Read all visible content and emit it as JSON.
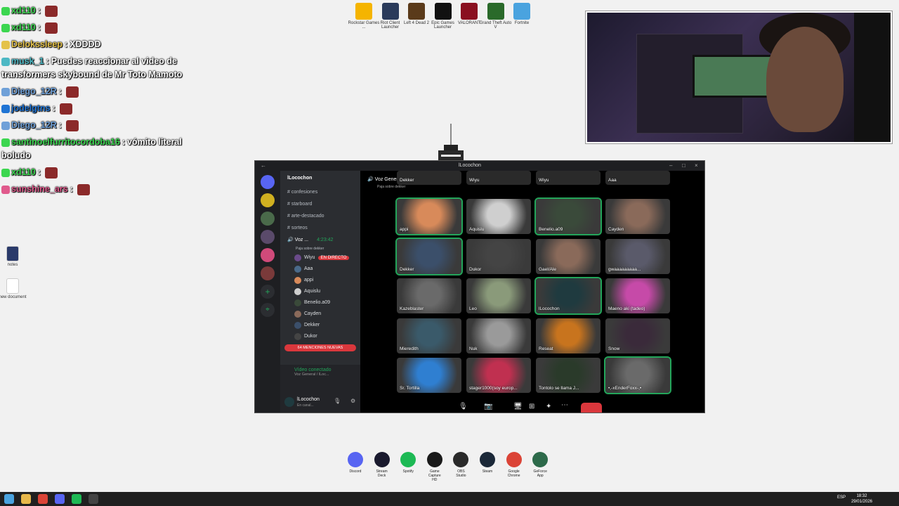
{
  "chat": [
    {
      "user": "xd110",
      "color": "#3cd650",
      "sep": ":",
      "text": "",
      "emote": true
    },
    {
      "user": "xd110",
      "color": "#3cd650",
      "sep": ":",
      "text": "",
      "emote": true
    },
    {
      "user": "Delokssleep",
      "color": "#e4c24a",
      "sep": ":",
      "text": "XDDDD",
      "emote": false
    },
    {
      "user": "musk_1",
      "color": "#4db8c4",
      "sep": ":",
      "text": "Puedes reaccionar al video de transformers skybound de Mr Toto Mamoto",
      "emote": false
    },
    {
      "user": "Diego_12R",
      "color": "#6fa0d8",
      "sep": ":",
      "text": "",
      "emote": true
    },
    {
      "user": "jodelgtns",
      "color": "#1f74d4",
      "sep": ":",
      "text": "",
      "emote": true
    },
    {
      "user": "Diego_12R",
      "color": "#6fa0d8",
      "sep": ":",
      "text": "",
      "emote": true
    },
    {
      "user": "santinoelfurritocordoba16",
      "color": "#3cd650",
      "sep": ":",
      "text": "vómito literal boludo",
      "emote": false
    },
    {
      "user": "xd110",
      "color": "#3cd650",
      "sep": ":",
      "text": "",
      "emote": true
    },
    {
      "user": "sunshine_ars",
      "color": "#e05a8c",
      "sep": ":",
      "text": "",
      "emote": true
    }
  ],
  "desktop_icons": [
    {
      "label": "Rockstar Games ..."
    },
    {
      "label": "Riot Client Launcher"
    },
    {
      "label": "Left 4 Dead 2"
    },
    {
      "label": "Epic Games Launcher"
    },
    {
      "label": "VALORANT"
    },
    {
      "label": "Grand Theft Auto V"
    },
    {
      "label": "Fortnite"
    }
  ],
  "left_icons": [
    {
      "label": "notes"
    },
    {
      "label": "new document"
    }
  ],
  "discord": {
    "window_title": "lLocochon",
    "server_name": "lLocochon",
    "channels": [
      {
        "name": "confesiones"
      },
      {
        "name": "starboard"
      },
      {
        "name": "arte-destacado"
      },
      {
        "name": "sorteos"
      }
    ],
    "voice_channel": "Voz ...",
    "voice_timer": "4:23:42",
    "voice_sub": "Paja sobre dekker",
    "voice_users": [
      {
        "name": "Wiyu",
        "live": "EN DIRECTO"
      },
      {
        "name": "Aaa"
      },
      {
        "name": "appi"
      },
      {
        "name": "Aquislu"
      },
      {
        "name": "Benelio.a09"
      },
      {
        "name": "Cayden"
      },
      {
        "name": "Dekker"
      },
      {
        "name": "Dukor"
      }
    ],
    "mentions": "64 MENCIONES NUEVAS",
    "connection_status": "Vídeo conectado",
    "connection_sub": "Voz General / lLoc...",
    "user_name": "lLocochon",
    "user_status": "En canal...",
    "stage_header": "Voz General",
    "stage_sub": "Paja sobre dekker",
    "top_row": [
      "Dekker",
      "Wiyu",
      "Wiyu",
      "Aaa"
    ],
    "tiles": [
      {
        "name": "appi",
        "color": "#d88a5a"
      },
      {
        "name": "Aquislu",
        "color": "#cfcfcf"
      },
      {
        "name": "Benelio.a09",
        "color": "#3a4a3a"
      },
      {
        "name": "Cayden",
        "color": "#8a6a5a"
      },
      {
        "name": "Dekker",
        "color": "#3b4f6a"
      },
      {
        "name": "Dukor",
        "color": "#444"
      },
      {
        "name": "Gael/Ale",
        "color": "#8a6a5a"
      },
      {
        "name": "gwaaaaaaaaa...",
        "color": "#5a5a6a"
      },
      {
        "name": "Kazeblaster",
        "color": "#6a6a6a"
      },
      {
        "name": "Leo",
        "color": "#8a9a7a"
      },
      {
        "name": "lLocochon",
        "color": "#1f3a3f"
      },
      {
        "name": "Maeno aki (tadeo)",
        "color": "#c64aa8"
      },
      {
        "name": "Mieredith",
        "color": "#3a5a6a"
      },
      {
        "name": "Nuk",
        "color": "#9a9a9a"
      },
      {
        "name": "Reseat",
        "color": "#c8741e"
      },
      {
        "name": "Snow",
        "color": "#3a2a3a"
      },
      {
        "name": "Sr. Tortilla",
        "color": "#2f7fd1"
      },
      {
        "name": "stager1000(soy europ...",
        "color": "#c03050"
      },
      {
        "name": "Tontolo se llama J...",
        "color": "#2a3a2a"
      },
      {
        "name": "•,-xEnderFoxx-,•",
        "color": "#6a6a6a"
      }
    ]
  },
  "dock": [
    {
      "label": "Discord",
      "color": "#5865f2"
    },
    {
      "label": "Stream Deck",
      "color": "#1a1a2e"
    },
    {
      "label": "Spotify",
      "color": "#1db954"
    },
    {
      "label": "Game Capture HD",
      "color": "#1a1a1a"
    },
    {
      "label": "OBS Studio",
      "color": "#2a2a2a"
    },
    {
      "label": "Steam",
      "color": "#1b2838"
    },
    {
      "label": "Google Chrome",
      "color": "#db4437"
    },
    {
      "label": "GeForce App",
      "color": "#2d6a4a"
    }
  ],
  "taskbar": {
    "lang": "ESP",
    "time": "18:32",
    "date": "29/01/2026"
  }
}
